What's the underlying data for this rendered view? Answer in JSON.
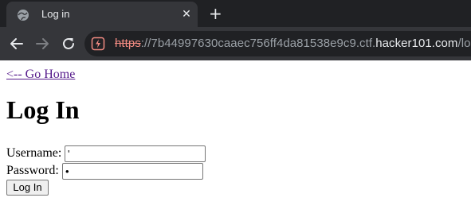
{
  "browser": {
    "tab": {
      "title": "Log in",
      "close_glyph": "✕",
      "favicon": "globe-icon"
    },
    "new_tab_glyph": "+",
    "address_bar": {
      "scheme": "https",
      "rest": "://7b44997630caaec756ff4da81538e9c9.ctf.",
      "domain": "hacker101.com",
      "path": "/login",
      "security_icon": "not-secure-icon"
    },
    "colors": {
      "tabstrip": "#202124",
      "toolbar": "#35363a",
      "warning": "#f28b82"
    }
  },
  "page": {
    "home_link": "<-- Go Home",
    "title": "Log In",
    "form": {
      "username_label": "Username:",
      "username_value": "'",
      "password_label": "Password:",
      "password_value": "•",
      "submit_label": "Log In"
    }
  }
}
